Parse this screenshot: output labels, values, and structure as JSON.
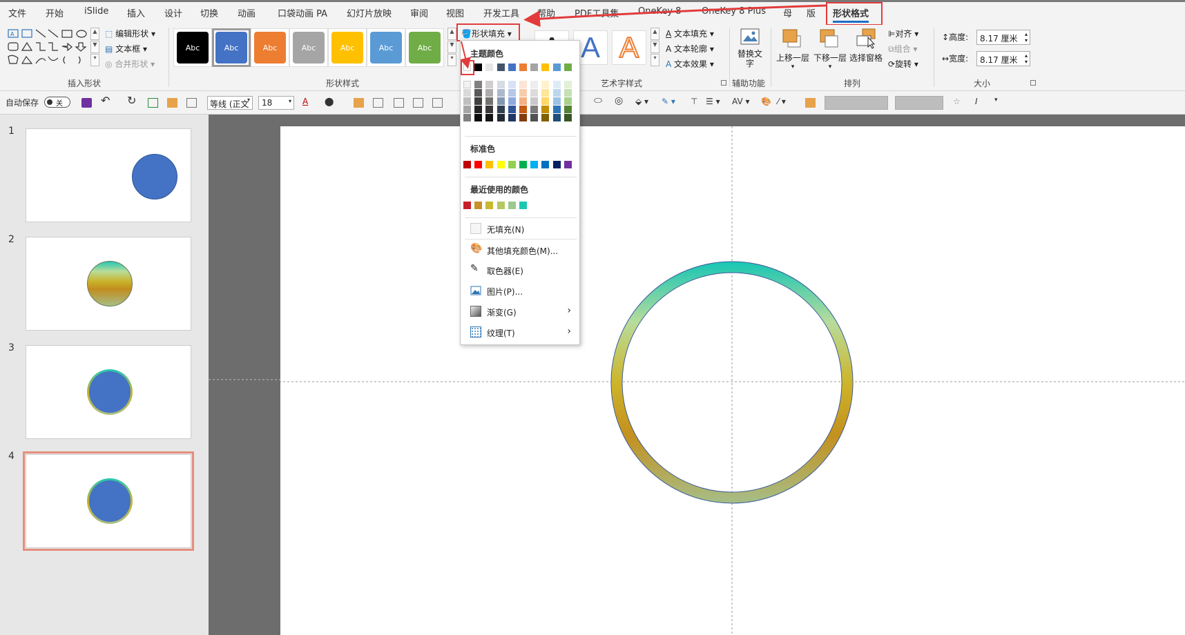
{
  "tabs": [
    "文件",
    "开始",
    "iSlide",
    "插入",
    "设计",
    "切换",
    "动画",
    "口袋动画 PA",
    "幻灯片放映",
    "审阅",
    "视图",
    "开发工具",
    "帮助",
    "PDF工具集",
    "OneKey 8",
    "OneKey 8 Plus",
    "母",
    "版",
    "形状格式"
  ],
  "active_tab": "形状格式",
  "ribbon": {
    "insert_shape": {
      "label": "插入形状",
      "edit_shape": "编辑形状",
      "text_box": "文本框",
      "merge_shape": "合并形状"
    },
    "shape_styles": {
      "label": "形状样式",
      "sample_text": "Abc",
      "fill_button": "形状填充",
      "colors": [
        "#000000",
        "#4472c4",
        "#ed7d31",
        "#a5a5a5",
        "#ffc000",
        "#5b9bd5",
        "#70ad47"
      ]
    },
    "art_text": {
      "label": "艺术字样式",
      "sample": "A",
      "text_fill": "文本填充",
      "text_outline": "文本轮廓",
      "text_effect": "文本效果"
    },
    "accessibility": {
      "label": "辅助功能",
      "alt_text": "替换文字"
    },
    "arrange": {
      "label": "排列",
      "bring_forward": "上移一层",
      "send_backward": "下移一层",
      "selection_pane": "选择窗格",
      "align": "对齐",
      "group": "组合",
      "rotate": "旋转"
    },
    "size": {
      "label": "大小",
      "height_label": "高度:",
      "height_value": "8.17 厘米",
      "width_label": "宽度:",
      "width_value": "8.17 厘米"
    }
  },
  "qat": {
    "autosave": "自动保存",
    "autosave_state": "关",
    "font": "等线 (正文",
    "font_size": "18"
  },
  "menu": {
    "theme_colors_label": "主题颜色",
    "standard_colors_label": "标准色",
    "recent_colors_label": "最近使用的颜色",
    "theme_top": [
      "#ffffff",
      "#000000",
      "#e7e6e6",
      "#44546a",
      "#4472c4",
      "#ed7d31",
      "#a5a5a5",
      "#ffc000",
      "#5b9bd5",
      "#70ad47"
    ],
    "theme_shades": [
      [
        "#f2f2f2",
        "#d9d9d9",
        "#bfbfbf",
        "#a6a6a6",
        "#808080"
      ],
      [
        "#808080",
        "#595959",
        "#404040",
        "#262626",
        "#0d0d0d"
      ],
      [
        "#d0cece",
        "#aeabab",
        "#757171",
        "#3a3838",
        "#171616"
      ],
      [
        "#d6dce4",
        "#adb9ca",
        "#8497b0",
        "#323f4f",
        "#222a35"
      ],
      [
        "#d9e2f3",
        "#b4c7e7",
        "#8faadc",
        "#2f5597",
        "#1f3864"
      ],
      [
        "#fbe5d6",
        "#f8cbad",
        "#f4b183",
        "#c55a11",
        "#843c0c"
      ],
      [
        "#ededed",
        "#dbdbdb",
        "#c9c9c9",
        "#7b7b7b",
        "#525252"
      ],
      [
        "#fff2cc",
        "#ffe699",
        "#ffd966",
        "#bf9000",
        "#7f6000"
      ],
      [
        "#deebf7",
        "#bdd7ee",
        "#9dc3e6",
        "#2e75b6",
        "#1f4e79"
      ],
      [
        "#e2f0d9",
        "#c5e0b4",
        "#a9d18e",
        "#548235",
        "#385723"
      ]
    ],
    "standard": [
      "#c00000",
      "#ff0000",
      "#ffc000",
      "#ffff00",
      "#92d050",
      "#00b050",
      "#00b0f0",
      "#0070c0",
      "#002060",
      "#7030a0"
    ],
    "recent": [
      "#c8202a",
      "#c8902a",
      "#c8b832",
      "#b4c864",
      "#9cc890",
      "#1cc8b0"
    ],
    "no_fill": "无填充(N)",
    "more_colors": "其他填充颜色(M)...",
    "eyedropper": "取色器(E)",
    "picture": "图片(P)...",
    "gradient": "渐变(G)",
    "texture": "纹理(T)"
  },
  "slides": [
    {
      "number": "1",
      "shape": "solid-circle"
    },
    {
      "number": "2",
      "shape": "gradient-circle"
    },
    {
      "number": "3",
      "shape": "ringed-circle"
    },
    {
      "number": "4",
      "shape": "ringed-circle",
      "selected": true
    }
  ]
}
